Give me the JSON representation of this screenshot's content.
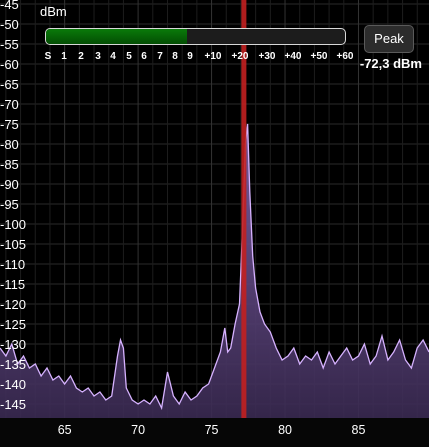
{
  "meter": {
    "unit_label": "dBm",
    "scale_labels": [
      "S",
      "1",
      "2",
      "3",
      "4",
      "5",
      "6",
      "7",
      "8",
      "9",
      "+10",
      "+20",
      "+30",
      "+40",
      "+50",
      "+60"
    ],
    "fill_fraction": 0.47,
    "fill_color": "#0a7a0a",
    "peak_button_label": "Peak",
    "level_readout": "-72,3 dBm"
  },
  "chart_data": {
    "type": "line",
    "ylabel": "dBm",
    "y_ticks": [
      "-45",
      "-50",
      "-55",
      "-60",
      "-65",
      "-70",
      "-75",
      "-80",
      "-85",
      "-90",
      "-95",
      "-100",
      "-105",
      "-110",
      "-115",
      "-120",
      "-125",
      "-130",
      "-135",
      "-140",
      "-145"
    ],
    "x_ticks": [
      "65",
      "70",
      "75",
      "80",
      "85"
    ],
    "x_tick_values": [
      65,
      70,
      75,
      80,
      85
    ],
    "xlim": [
      60.6,
      89.8
    ],
    "ylim": [
      -148.5,
      -44
    ],
    "grid": true,
    "marker": {
      "x": 77.2,
      "color": "#c22020"
    },
    "series_color": "#d6b2ff",
    "fill_color": "#6b4f8f",
    "spectrum": {
      "x": [
        60.6,
        61.0,
        61.4,
        61.8,
        62.2,
        62.6,
        63.0,
        63.4,
        63.8,
        64.2,
        64.6,
        65.0,
        65.4,
        65.8,
        66.2,
        66.6,
        67.0,
        67.4,
        67.8,
        68.2,
        68.6,
        68.8,
        69.0,
        69.2,
        69.6,
        70.0,
        70.4,
        70.8,
        71.2,
        71.6,
        72.0,
        72.4,
        72.8,
        73.2,
        73.6,
        74.0,
        74.4,
        74.8,
        75.2,
        75.6,
        75.9,
        76.1,
        76.3,
        76.6,
        76.9,
        77.1,
        77.3,
        77.45,
        77.6,
        77.8,
        78.0,
        78.3,
        78.6,
        79.0,
        79.4,
        79.8,
        80.2,
        80.6,
        81.0,
        81.4,
        81.8,
        82.2,
        82.6,
        83.0,
        83.4,
        83.8,
        84.2,
        84.6,
        85.0,
        85.4,
        85.8,
        86.2,
        86.6,
        87.0,
        87.4,
        87.8,
        88.2,
        88.6,
        89.0,
        89.4,
        89.8
      ],
      "y": [
        -131,
        -133,
        -130,
        -135,
        -133,
        -136,
        -135,
        -138,
        -136,
        -139,
        -138,
        -140,
        -138,
        -141,
        -142,
        -141,
        -143,
        -142,
        -144,
        -143,
        -133,
        -129,
        -131,
        -141,
        -144,
        -145,
        -144,
        -145,
        -143,
        -146,
        -137,
        -143,
        -145,
        -142,
        -144,
        -143,
        -141,
        -140,
        -136,
        -132,
        -126,
        -132,
        -131,
        -125,
        -120,
        -102,
        -80,
        -75,
        -92,
        -108,
        -116,
        -122,
        -125,
        -127,
        -131,
        -134,
        -133,
        -131,
        -135,
        -133,
        -134,
        -132,
        -136,
        -132,
        -135,
        -133,
        -131,
        -134,
        -133,
        -130,
        -135,
        -133,
        -128,
        -134,
        -132,
        -129,
        -134,
        -136,
        -131,
        -129,
        -132
      ]
    }
  }
}
